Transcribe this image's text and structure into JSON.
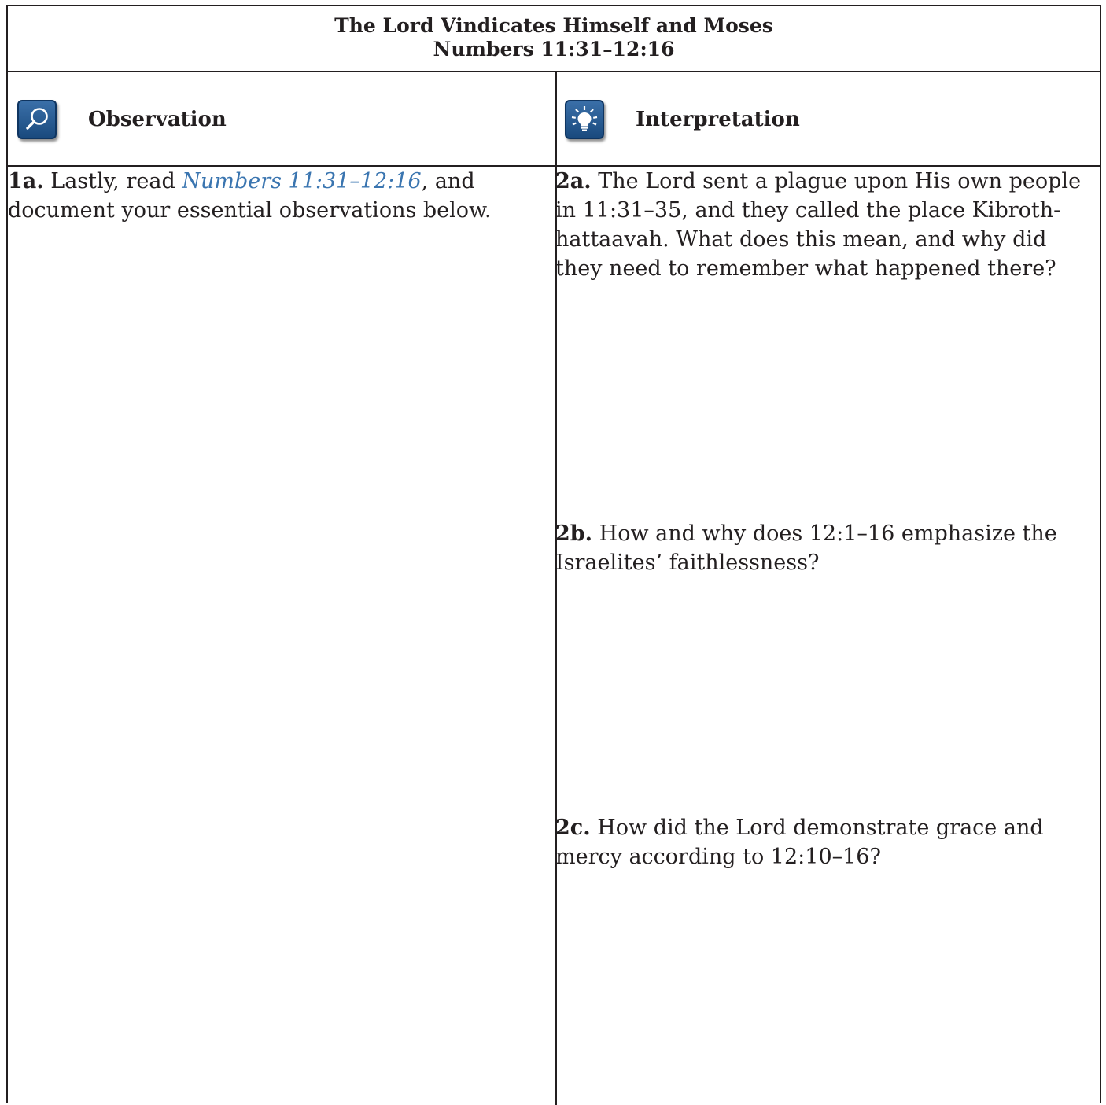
{
  "title": {
    "line1": "The Lord Vindicates Himself and Moses",
    "line2": "Numbers 11:31–12:16"
  },
  "columns": {
    "observation": {
      "label": "Observation",
      "icon": "magnifying-glass-icon"
    },
    "interpretation": {
      "label": "Interpretation",
      "icon": "lightbulb-icon"
    }
  },
  "icon_color": "#1f5590",
  "link_color": "#3a75b0",
  "questions": {
    "q1a": {
      "number": "1a.",
      "text_before": " Lastly, read ",
      "reference": "Numbers 11:31–12:16",
      "text_after": ", and document your essential observations below."
    },
    "q2a": {
      "number": "2a.",
      "text": " The Lord sent a plague upon His own people in 11:31–35, and they called the place Kibroth-hattaavah. What does this mean, and why did they need to remember what happened there?"
    },
    "q2b": {
      "number": "2b.",
      "text": " How and why does 12:1–16 emphasize the Israelites’ faithlessness?"
    },
    "q2c": {
      "number": "2c.",
      "text": " How did the Lord demonstrate grace and mercy according to 12:10–16?"
    }
  }
}
